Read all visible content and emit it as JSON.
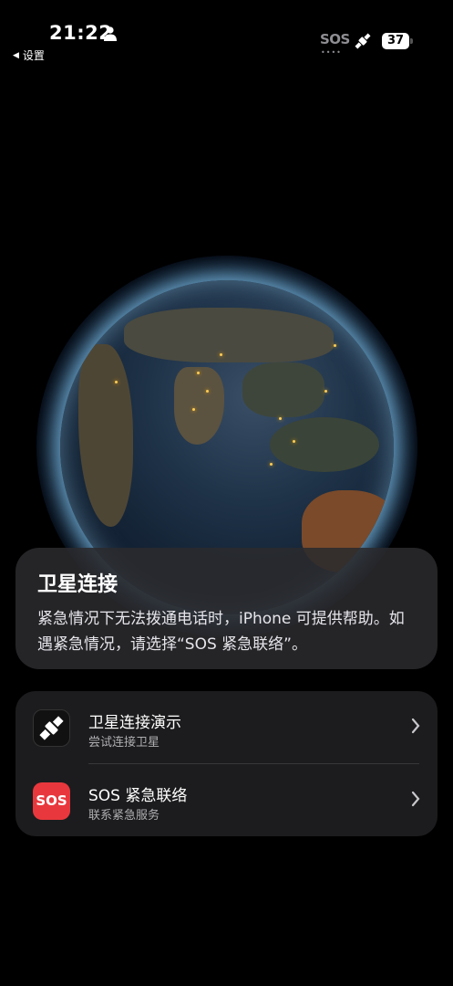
{
  "status_bar": {
    "time": "21:22",
    "back_label": "设置",
    "sos_text": "SOS",
    "sos_dots": "••••",
    "battery": "37"
  },
  "info_card": {
    "title": "卫星连接",
    "description": "紧急情况下无法拨通电话时，iPhone 可提供帮助。如遇紧急情况，请选择“SOS 紧急联络”。"
  },
  "list": {
    "items": [
      {
        "icon": "satellite-icon",
        "title": "卫星连接演示",
        "subtitle": "尝试连接卫星"
      },
      {
        "icon": "sos-icon",
        "icon_text": "SOS",
        "title": "SOS 紧急联络",
        "subtitle": "联系紧急服务"
      }
    ]
  },
  "colors": {
    "sos_red": "#e8383d",
    "card_bg": "#2a2a2e",
    "list_bg": "#1c1c1e"
  }
}
